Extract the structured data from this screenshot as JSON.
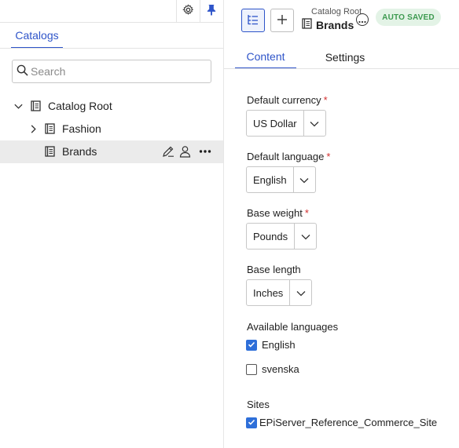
{
  "left_pane": {
    "tab_label": "Catalogs",
    "search": {
      "placeholder": "Search",
      "value": ""
    },
    "tree": [
      {
        "label": "Catalog Root",
        "expanded": true,
        "icon": "catalog-icon"
      },
      {
        "label": "Fashion",
        "expanded": false,
        "icon": "catalog-icon"
      },
      {
        "label": "Brands",
        "selected": true,
        "icon": "catalog-icon"
      }
    ]
  },
  "header": {
    "breadcrumb_parent": "Catalog Root",
    "title": "Brands",
    "status_badge": "AUTO SAVED"
  },
  "tabs": [
    {
      "label": "Content",
      "active": true
    },
    {
      "label": "Settings",
      "active": false
    }
  ],
  "form": {
    "default_currency": {
      "label": "Default currency",
      "required": "*",
      "value": "US Dollar"
    },
    "default_language": {
      "label": "Default language",
      "required": "*",
      "value": "English"
    },
    "base_weight": {
      "label": "Base weight",
      "required": "*",
      "value": "Pounds"
    },
    "base_length": {
      "label": "Base length",
      "value": "Inches"
    },
    "available_languages": {
      "label": "Available languages",
      "options": [
        {
          "label": "English",
          "checked": true
        },
        {
          "label": "svenska",
          "checked": false
        }
      ]
    },
    "sites": {
      "label": "Sites",
      "options": [
        {
          "label": "EPiServer_Reference_Commerce_Site",
          "checked": true
        }
      ]
    }
  },
  "colors": {
    "accent": "#2e54c9",
    "badge_bg": "#e3f3e6",
    "badge_text": "#3d9a50",
    "required": "#d32f2f",
    "checkbox": "#2e6fd9"
  }
}
